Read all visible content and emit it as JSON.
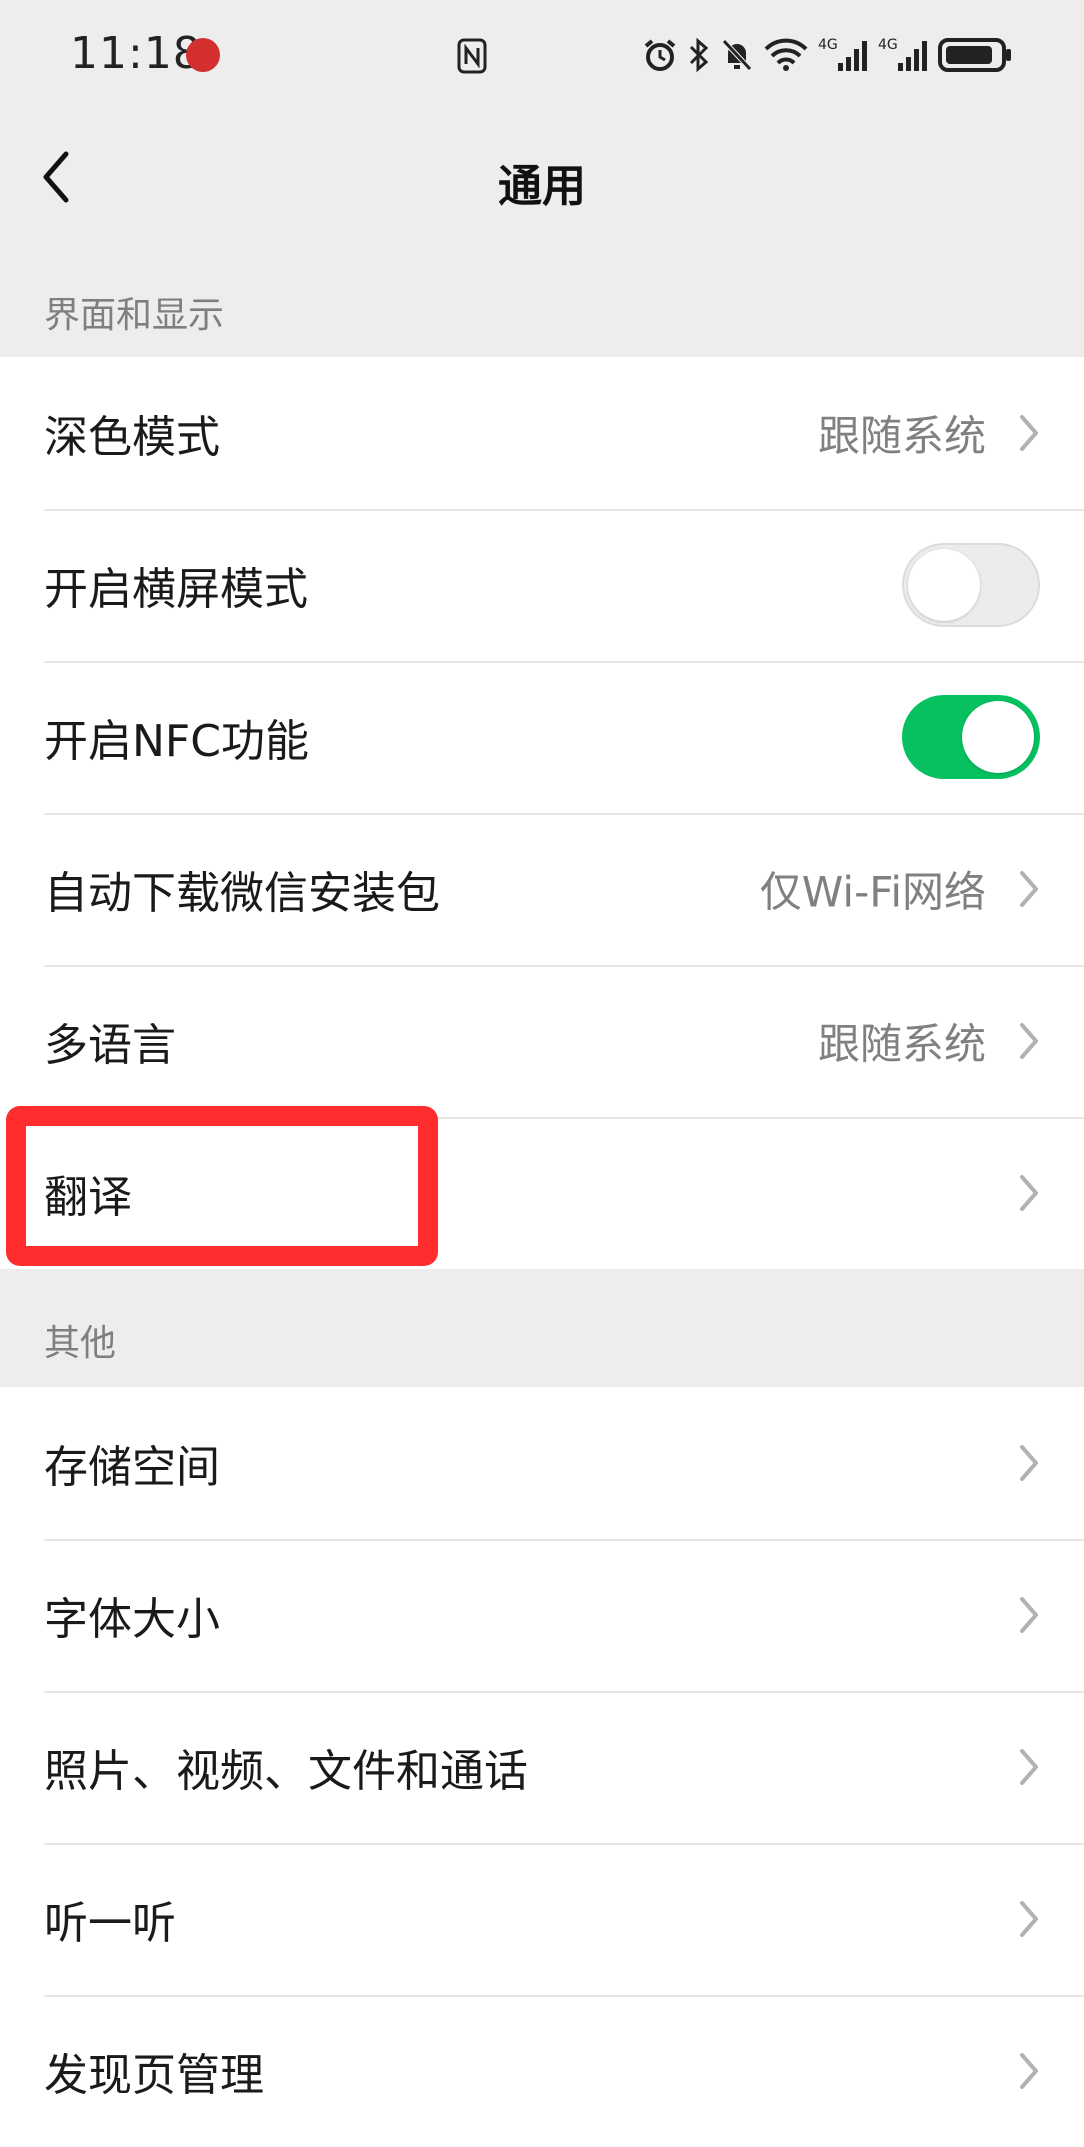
{
  "status_bar": {
    "time": "11:18",
    "network_1": "4G",
    "network_2": "4G"
  },
  "nav": {
    "title": "通用"
  },
  "sections": [
    {
      "header": "界面和显示",
      "rows": [
        {
          "label": "深色模式",
          "value": "跟随系统",
          "type": "link"
        },
        {
          "label": "开启横屏模式",
          "type": "toggle",
          "on": false
        },
        {
          "label": "开启NFC功能",
          "type": "toggle",
          "on": true
        },
        {
          "label": "自动下载微信安装包",
          "value": "仅Wi-Fi网络",
          "type": "link"
        },
        {
          "label": "多语言",
          "value": "跟随系统",
          "type": "link"
        },
        {
          "label": "翻译",
          "type": "link"
        }
      ]
    },
    {
      "header": "其他",
      "rows": [
        {
          "label": "存储空间",
          "type": "link"
        },
        {
          "label": "字体大小",
          "type": "link"
        },
        {
          "label": "照片、视频、文件和通话",
          "type": "link"
        },
        {
          "label": "听一听",
          "type": "link"
        },
        {
          "label": "发现页管理",
          "type": "link"
        }
      ]
    }
  ],
  "colors": {
    "background": "#ededed",
    "toggle_on": "#07c160",
    "highlight": "#ff2d2d"
  }
}
